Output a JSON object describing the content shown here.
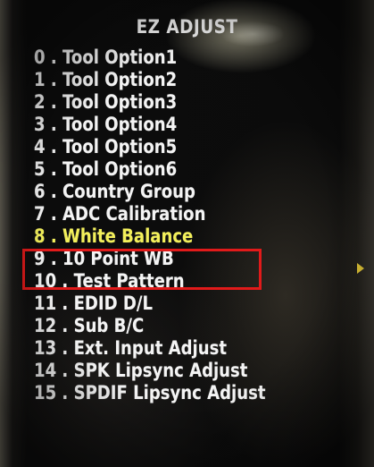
{
  "menu": {
    "title": "EZ ADJUST",
    "selected_index": 8,
    "items": [
      {
        "label": "0 . Tool Option1"
      },
      {
        "label": "1 . Tool Option2"
      },
      {
        "label": "2 . Tool Option3"
      },
      {
        "label": "3 . Tool Option4"
      },
      {
        "label": "4 . Tool Option5"
      },
      {
        "label": "5 . Tool Option6"
      },
      {
        "label": "6 . Country Group"
      },
      {
        "label": "7 . ADC Calibration"
      },
      {
        "label": "8 . White Balance"
      },
      {
        "label": "9 . 10 Point WB"
      },
      {
        "label": "10 . Test Pattern"
      },
      {
        "label": "11 . EDID D/L"
      },
      {
        "label": "12 . Sub B/C"
      },
      {
        "label": "13 . Ext. Input Adjust"
      },
      {
        "label": "14 . SPK Lipsync Adjust"
      },
      {
        "label": "15 . SPDIF Lipsync Adjust"
      }
    ]
  },
  "colors": {
    "item_text": "#f4f4f4",
    "selected_text": "#f3f05a",
    "highlight_border": "#e11a1a",
    "arrow": "#f0d23a"
  },
  "icons": {
    "submenu_arrow": "arrow-right-icon"
  }
}
